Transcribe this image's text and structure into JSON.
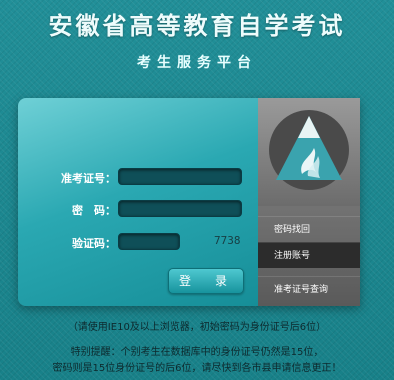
{
  "header": {
    "title": "安徽省高等教育自学考试",
    "subtitle": "考生服务平台"
  },
  "form": {
    "exam_id_label": "准考证号：",
    "password_label": "密　码：",
    "captcha_label": "验证码：",
    "captcha_code": "7738",
    "login_label": "登　录"
  },
  "sidebar": {
    "items": [
      {
        "label": "密码找回"
      },
      {
        "label": "注册账号"
      },
      {
        "label": "准考证号查询"
      }
    ]
  },
  "notices": {
    "browser": "（请使用IE10及以上浏览器，初始密码为身份证号后6位）",
    "special_line1": "特别提醒：个别考生在数据库中的身份证号仍然是15位，",
    "special_line2": "密码则是15位身份证号的后6位，请尽快到各市县申请信息更正！"
  },
  "colors": {
    "background": "#1d8e96",
    "panel_accent": "#2aa8b2",
    "sidebar": "#6c6c6c"
  }
}
